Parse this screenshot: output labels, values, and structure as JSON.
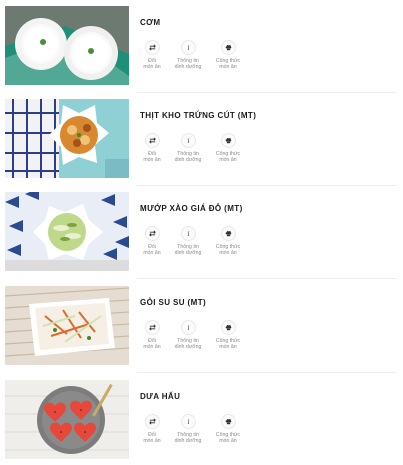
{
  "dishes": [
    {
      "name": "CƠM",
      "image": "two bowls of white rice on green tablecloth"
    },
    {
      "name": "THỊT KHO TRỨNG CÚT (MT)",
      "image": "braised pork with quail eggs in white bowl"
    },
    {
      "name": "MƯỚP XÀO GIÁ ĐỖ (MT)",
      "image": "stir-fried luffa with bean sprouts"
    },
    {
      "name": "GỎI SU SU (MT)",
      "image": "chayote salad with carrot"
    },
    {
      "name": "DƯA HẤU",
      "image": "sliced watermelon on grey plate"
    }
  ],
  "actions": {
    "swap_label": "Đổi\nmón ăn",
    "info_label": "Thông tin\ndinh dưỡng",
    "recipe_label": "Công thức\nmón ăn"
  },
  "icons": {
    "swap": "swap-arrows-icon",
    "info": "info-icon",
    "recipe": "chef-hat-icon"
  },
  "colors": {
    "text": "#1a1a1a",
    "muted": "#8a8a8a",
    "divider": "#eeeeee"
  }
}
